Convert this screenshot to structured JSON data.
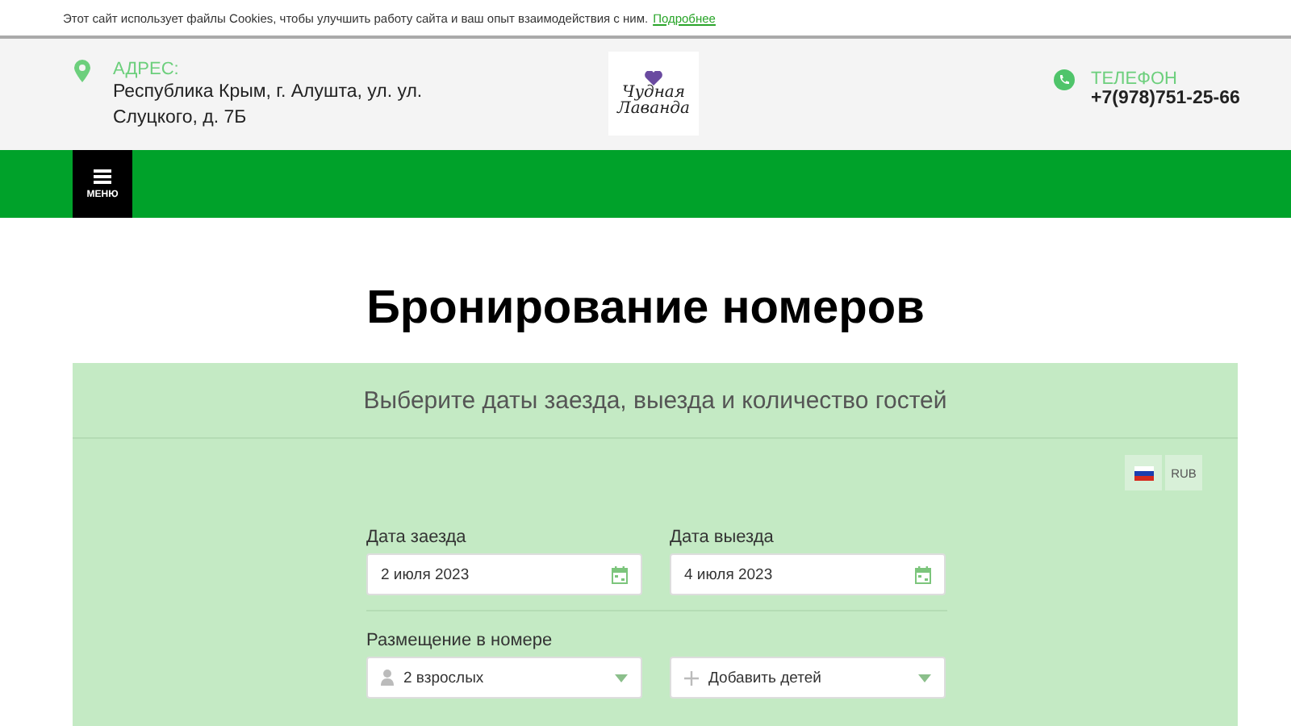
{
  "cookie_bar": {
    "text": "Этот сайт использует файлы Cookies, чтобы улучшить работу сайта и ваш опыт взаимодействия с ним.",
    "link": "Подробнее"
  },
  "header": {
    "address": {
      "label": "АДРЕС:",
      "value": "Республика Крым, г. Алушта, ул. ул. Слуцкого, д. 7Б"
    },
    "logo": {
      "line_1": "Чудная",
      "line_2": "Лаванда"
    },
    "phone": {
      "label": "ТЕЛЕФОН",
      "value": "+7(978)751-25-66"
    }
  },
  "nav": {
    "menu_label": "МЕНЮ"
  },
  "page_title": "Бронирование номеров",
  "booking": {
    "subtitle": "Выберите даты заезда, выезда и количество гостей",
    "currency": "RUB",
    "dates": [
      {
        "label": "Дата заезда",
        "value": "2 июля 2023"
      },
      {
        "label": "Дата выезда",
        "value": "4 июля 2023"
      }
    ],
    "placement_label": "Размещение в номере",
    "guests": [
      {
        "kind": "adults",
        "value": "2 взрослых"
      },
      {
        "kind": "children",
        "value": "Добавить детей"
      }
    ]
  }
}
